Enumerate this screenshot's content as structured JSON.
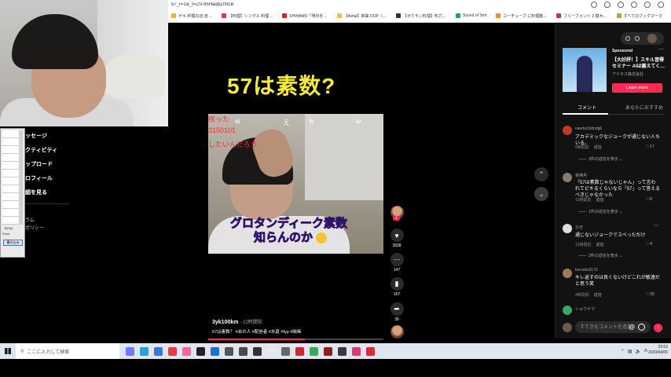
{
  "browser": {
    "url": "57_r=1&_t=ZS-95HaqbZml1B",
    "bookmarks": [
      {
        "label": "ゲキ 料理の店 自…",
        "color": "#f0b030"
      },
      {
        "label": "【料理】シングル 料理…",
        "color": "#d04040"
      },
      {
        "label": "SHIHAMO「明日を…",
        "color": "#e02020"
      },
      {
        "label": "【Avital】新曲 DOP（…",
        "color": "#f0c040"
      },
      {
        "label": "【ボケモン料理】料力…",
        "color": "#333333"
      },
      {
        "label": "Sound of Smt",
        "color": "#20a090"
      },
      {
        "label": "ユーチューブ に料理動…",
        "color": "#f09020"
      },
      {
        "label": "フリーフォント 2 樹木…",
        "color": "#d03050"
      },
      {
        "label": "すべてのブックマーク",
        "color": "#c0a040"
      }
    ]
  },
  "sidebar": {
    "items": [
      "ッセージ",
      "クティビティ",
      "ップロード",
      "ロフィール",
      "細を見る"
    ],
    "small": [
      "ラム",
      "ポリシー",
      "TikTok"
    ]
  },
  "excel": {
    "labels": [
      "Form",
      "TikTok"
    ],
    "button": "書き込み"
  },
  "video": {
    "title": "57は素数?",
    "overlay_red": [
      "咲った",
      "3150101",
      "したいんだろう"
    ],
    "overlay_w": [
      "w",
      "え",
      "w",
      "w"
    ],
    "caption_line1": "グロタンディーク素数",
    "caption_line2": "知らんのか",
    "username": "3yk100km",
    "time": "· 22時間前",
    "description": "57は素数？ #あの人 #配信者 #水頁 #fyp #映画",
    "progress": 0.55
  },
  "actions": {
    "likes": "2838",
    "comments": "147",
    "saves": "167",
    "shares": "35"
  },
  "ad": {
    "sponsored": "Sponsored",
    "title": "【大好評！】スキル習得セミナー AIは鍛えてく…",
    "company": "アドネス株式会社",
    "button": "Learn more"
  },
  "tabs": {
    "comments": "コメント",
    "recommended": "あなたにおすすめ"
  },
  "comments": [
    {
      "user": "usertsz1tdnrlg6",
      "text": "アカデミックなジョークが通じない人ちいる。",
      "time": "9時間前",
      "reply": "返信",
      "likes": "17",
      "replies": "3件の返信を表示 ⌄",
      "avatar_color": "#c0392b"
    },
    {
      "user": "夜神月",
      "text": "「57は素数じゃないじゃん」って言われてピキるくらいなら「57」って答えるべきじゃなかった",
      "time": "10時間前",
      "reply": "返信",
      "likes": "8",
      "replies": "1件の返信を表示 ⌄",
      "avatar_color": "#8a7a6a"
    },
    {
      "user": "なぜ",
      "text": "通じないジョークでスベっただけ",
      "time": "12時間前",
      "reply": "返信",
      "likes": "4",
      "replies": "3件の返信を表示 ⌄",
      "avatar_color": "#dddddd"
    },
    {
      "user": "koronks3170",
      "text": "キレ返すのは良くないけどこれが敏速だと思う笑",
      "time": "4時間前",
      "reply": "返信",
      "likes": "35",
      "replies": "",
      "avatar_color": "#9a7b5a"
    },
    {
      "user": "ショウヤマ",
      "text": "",
      "time": "",
      "reply": "",
      "likes": "",
      "replies": "",
      "avatar_color": "#3aa860"
    }
  ],
  "comment_input": {
    "placeholder": "すてきなコメントを追加…"
  },
  "taskbar": {
    "search_placeholder": "ここに入力して検索",
    "clock_time": "23:52",
    "clock_date": "2020/04/05",
    "lang": "A"
  }
}
